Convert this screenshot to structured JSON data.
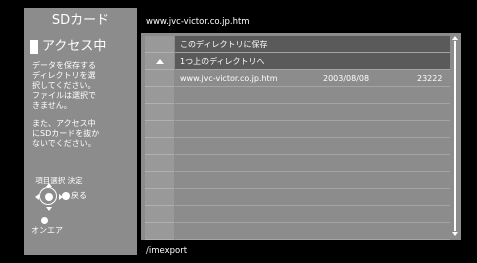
{
  "left_panel": {
    "title": "SDカード",
    "status": "アクセス中",
    "help_text_1": "データを保存する\nディレクトリを選\n択してください。\nファイルは選択で\nきません。",
    "help_text_2": "また、アクセス中\nにSDカードを抜か\nないでください。",
    "controls_label": "項目選択 決定",
    "back_label": "戻る",
    "onair_label": "オンエア"
  },
  "url_bar": {
    "text": "www.jvc-victor.co.jp.htm"
  },
  "file_list": {
    "rows": [
      {
        "name": "このディレクトリに保存",
        "date": "",
        "size": "",
        "selected": true,
        "icon": ""
      },
      {
        "name": "1つ上のディレクトリへ",
        "date": "",
        "size": "",
        "selected": true,
        "icon": "up-arrow-icon"
      },
      {
        "name": "www.jvc-victor.co.jp.htm",
        "date": "2003/08/08",
        "size": "23222",
        "selected": false,
        "icon": ""
      }
    ],
    "empty_rows": 9
  },
  "path_bar": {
    "text": "/imexport"
  },
  "colors": {
    "panel": "#8c8c8c",
    "selected_row": "#5a5a5a",
    "bars": "#000000",
    "text": "#ffffff"
  }
}
